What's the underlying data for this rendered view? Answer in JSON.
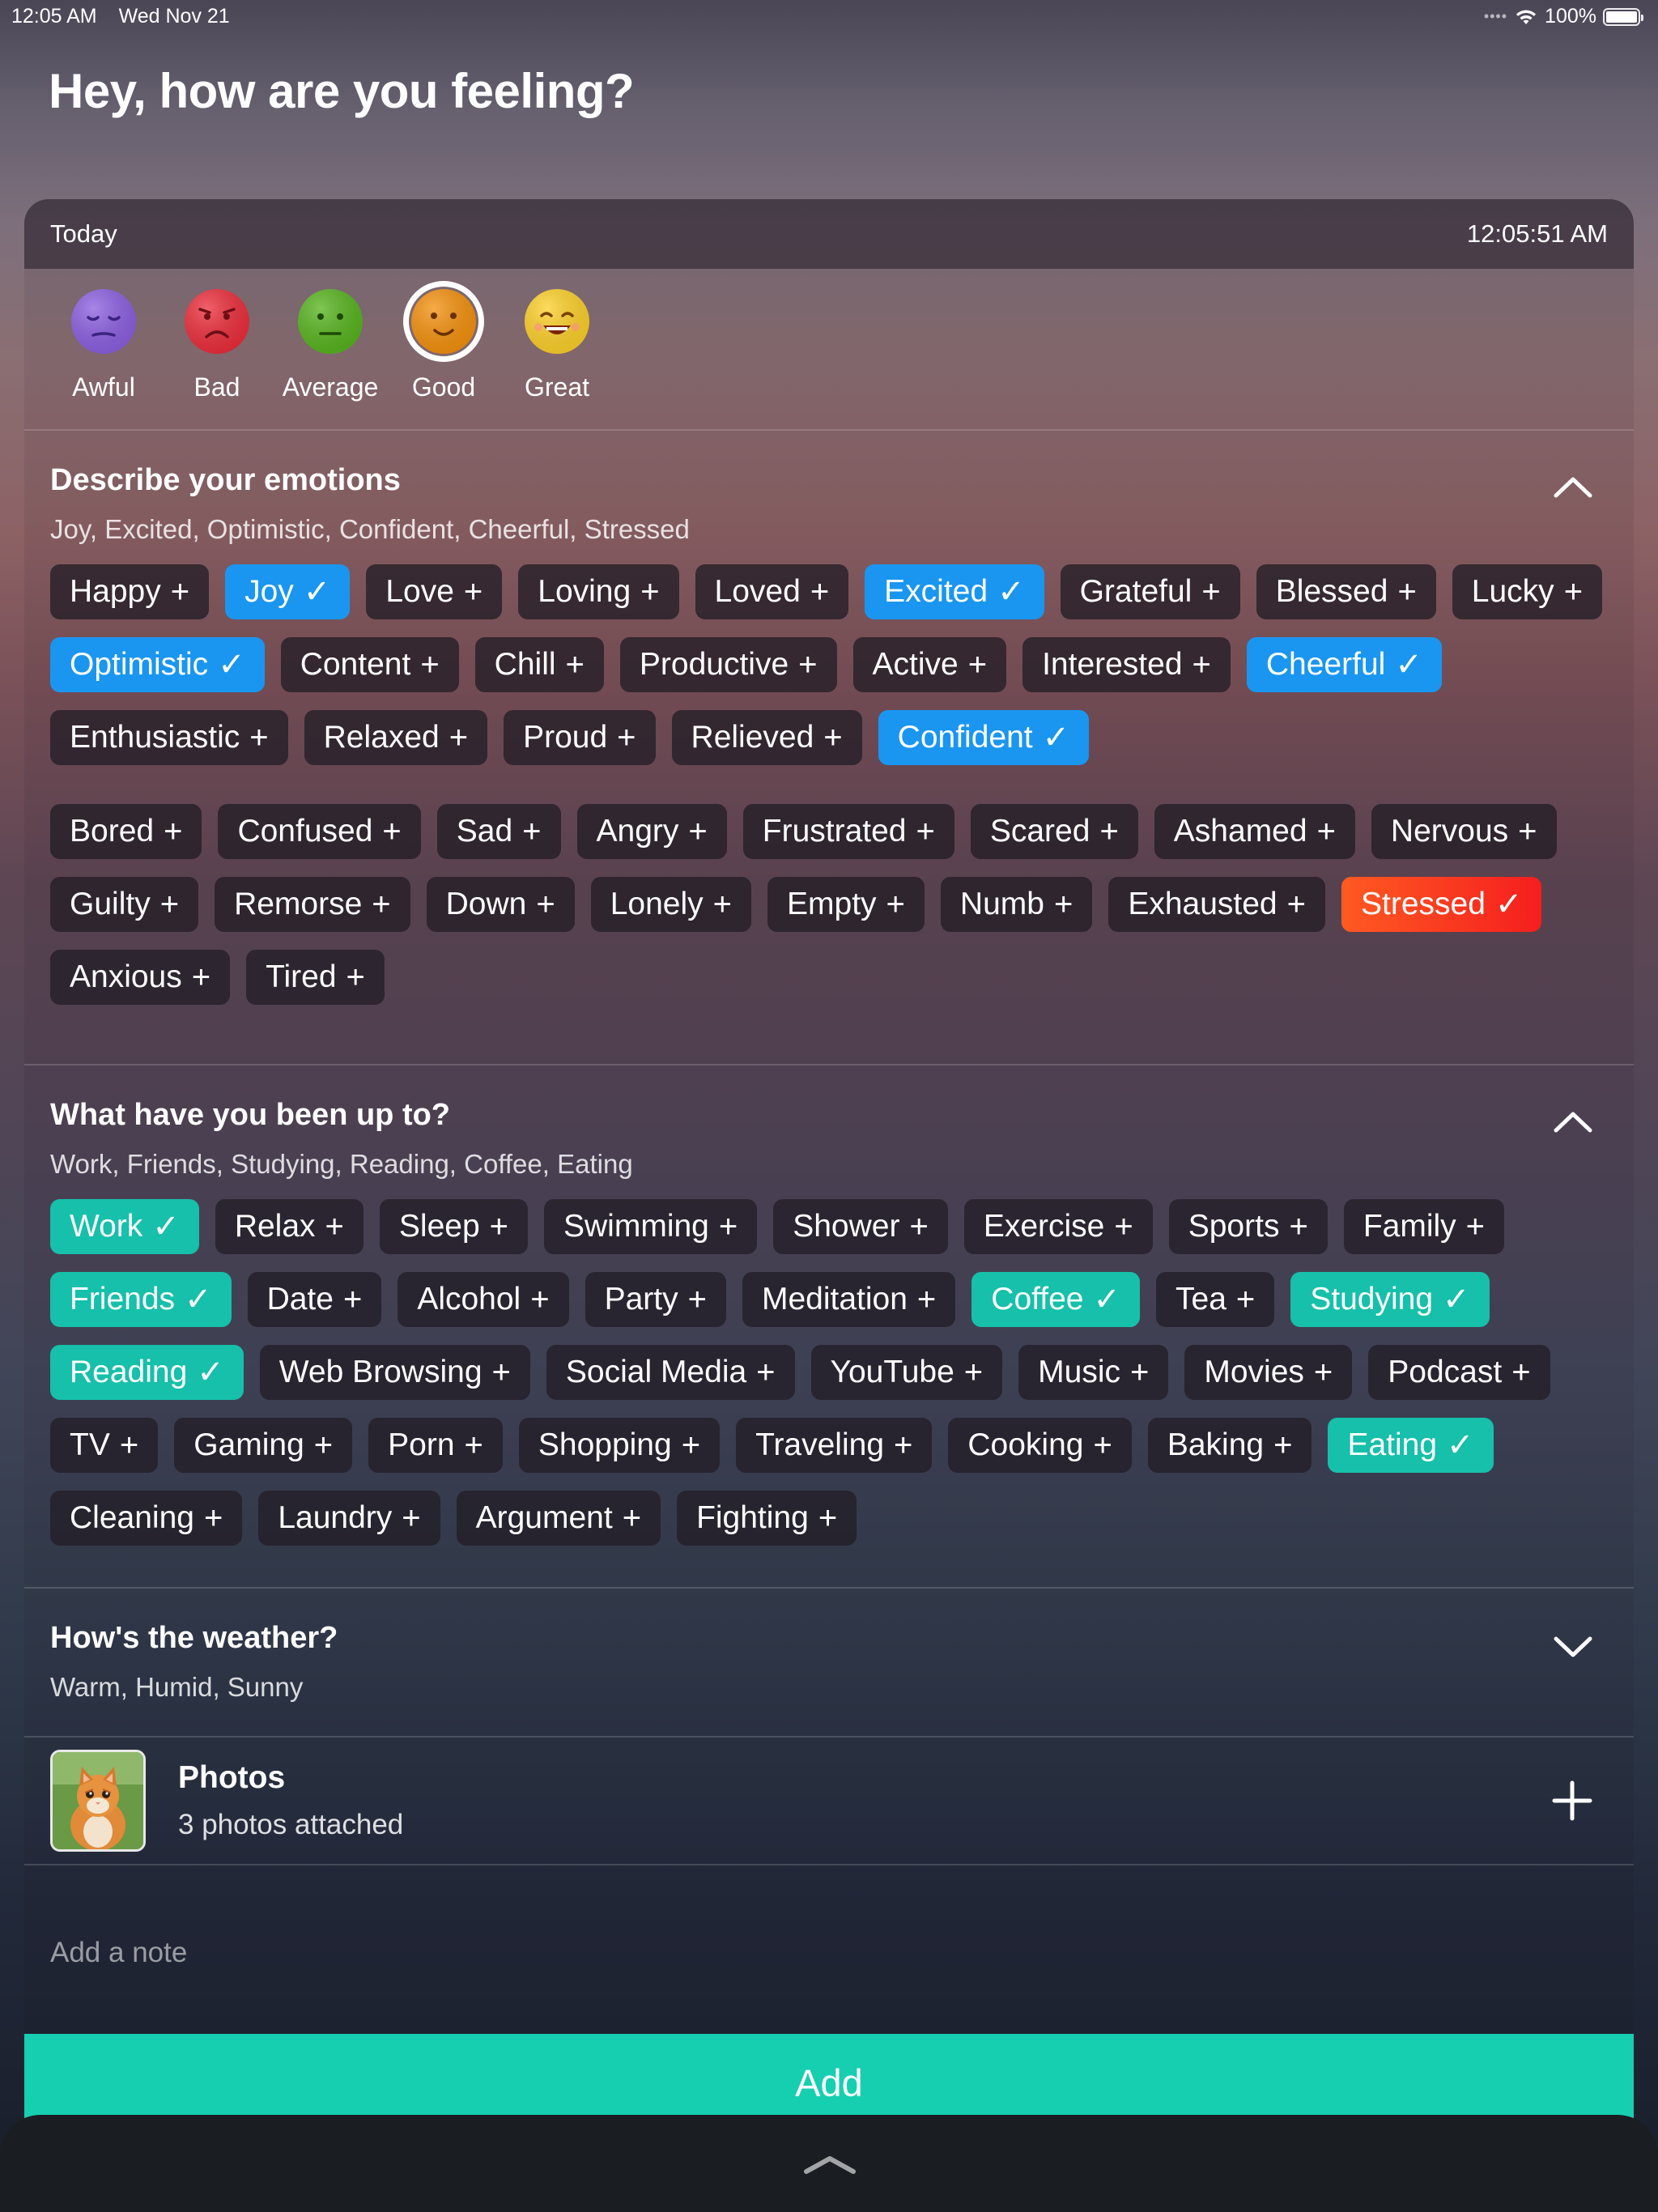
{
  "status_bar": {
    "time": "12:05 AM",
    "date": "Wed Nov 21",
    "battery": "100%"
  },
  "title": "Hey, how are you feeling?",
  "entry": {
    "day": "Today",
    "time": "12:05:51 AM"
  },
  "moods": [
    {
      "label": "Awful",
      "icon": "sad-purple-face-icon",
      "color": "#8b5ee0",
      "selected": false
    },
    {
      "label": "Bad",
      "icon": "frown-red-face-icon",
      "color": "#ec2c39",
      "selected": false
    },
    {
      "label": "Average",
      "icon": "neutral-green-face-icon",
      "color": "#56b41d",
      "selected": false
    },
    {
      "label": "Good",
      "icon": "smile-orange-face-icon",
      "color": "#f4900c",
      "selected": true
    },
    {
      "label": "Great",
      "icon": "grin-yellow-face-icon",
      "color": "#fdd028",
      "selected": false
    }
  ],
  "emotions": {
    "title": "Describe your emotions",
    "summary": "Joy, Excited, Optimistic, Confident, Cheerful, Stressed",
    "positive": [
      {
        "label": "Happy",
        "selected": false
      },
      {
        "label": "Joy",
        "selected": true
      },
      {
        "label": "Love",
        "selected": false
      },
      {
        "label": "Loving",
        "selected": false
      },
      {
        "label": "Loved",
        "selected": false
      },
      {
        "label": "Excited",
        "selected": true
      },
      {
        "label": "Grateful",
        "selected": false
      },
      {
        "label": "Blessed",
        "selected": false
      },
      {
        "label": "Lucky",
        "selected": false
      },
      {
        "label": "Optimistic",
        "selected": true
      },
      {
        "label": "Content",
        "selected": false
      },
      {
        "label": "Chill",
        "selected": false
      },
      {
        "label": "Productive",
        "selected": false
      },
      {
        "label": "Active",
        "selected": false
      },
      {
        "label": "Interested",
        "selected": false
      },
      {
        "label": "Cheerful",
        "selected": true
      },
      {
        "label": "Enthusiastic",
        "selected": false
      },
      {
        "label": "Relaxed",
        "selected": false
      },
      {
        "label": "Proud",
        "selected": false
      },
      {
        "label": "Relieved",
        "selected": false
      },
      {
        "label": "Confident",
        "selected": true
      }
    ],
    "negative": [
      {
        "label": "Bored",
        "selected": false
      },
      {
        "label": "Confused",
        "selected": false
      },
      {
        "label": "Sad",
        "selected": false
      },
      {
        "label": "Angry",
        "selected": false
      },
      {
        "label": "Frustrated",
        "selected": false
      },
      {
        "label": "Scared",
        "selected": false
      },
      {
        "label": "Ashamed",
        "selected": false
      },
      {
        "label": "Nervous",
        "selected": false
      },
      {
        "label": "Guilty",
        "selected": false
      },
      {
        "label": "Remorse",
        "selected": false
      },
      {
        "label": "Down",
        "selected": false
      },
      {
        "label": "Lonely",
        "selected": false
      },
      {
        "label": "Empty",
        "selected": false
      },
      {
        "label": "Numb",
        "selected": false
      },
      {
        "label": "Exhausted",
        "selected": false
      },
      {
        "label": "Stressed",
        "selected": true
      },
      {
        "label": "Anxious",
        "selected": false
      },
      {
        "label": "Tired",
        "selected": false
      }
    ]
  },
  "activities": {
    "title": "What have you been up to?",
    "summary": "Work, Friends, Studying, Reading, Coffee, Eating",
    "items": [
      {
        "label": "Work",
        "selected": true
      },
      {
        "label": "Relax",
        "selected": false
      },
      {
        "label": "Sleep",
        "selected": false
      },
      {
        "label": "Swimming",
        "selected": false
      },
      {
        "label": "Shower",
        "selected": false
      },
      {
        "label": "Exercise",
        "selected": false
      },
      {
        "label": "Sports",
        "selected": false
      },
      {
        "label": "Family",
        "selected": false
      },
      {
        "label": "Friends",
        "selected": true
      },
      {
        "label": "Date",
        "selected": false
      },
      {
        "label": "Alcohol",
        "selected": false
      },
      {
        "label": "Party",
        "selected": false
      },
      {
        "label": "Meditation",
        "selected": false
      },
      {
        "label": "Coffee",
        "selected": true
      },
      {
        "label": "Tea",
        "selected": false
      },
      {
        "label": "Studying",
        "selected": true
      },
      {
        "label": "Reading",
        "selected": true
      },
      {
        "label": "Web Browsing",
        "selected": false
      },
      {
        "label": "Social Media",
        "selected": false
      },
      {
        "label": "YouTube",
        "selected": false
      },
      {
        "label": "Music",
        "selected": false
      },
      {
        "label": "Movies",
        "selected": false
      },
      {
        "label": "Podcast",
        "selected": false
      },
      {
        "label": "TV",
        "selected": false
      },
      {
        "label": "Gaming",
        "selected": false
      },
      {
        "label": "Porn",
        "selected": false
      },
      {
        "label": "Shopping",
        "selected": false
      },
      {
        "label": "Traveling",
        "selected": false
      },
      {
        "label": "Cooking",
        "selected": false
      },
      {
        "label": "Baking",
        "selected": false
      },
      {
        "label": "Eating",
        "selected": true
      },
      {
        "label": "Cleaning",
        "selected": false
      },
      {
        "label": "Laundry",
        "selected": false
      },
      {
        "label": "Argument",
        "selected": false
      },
      {
        "label": "Fighting",
        "selected": false
      }
    ]
  },
  "weather": {
    "title": "How's the weather?",
    "summary": "Warm, Humid, Sunny"
  },
  "photos": {
    "title": "Photos",
    "subtitle": "3 photos attached",
    "thumbnail": "kitten-photo"
  },
  "note": {
    "placeholder": "Add a note"
  },
  "add_button": "Add",
  "colors": {
    "emotion_positive_selected": "#1a96f0",
    "emotion_negative_selected": "#f53a1e",
    "activity_selected": "#16c0aa",
    "add_button": "#16cfb0"
  }
}
